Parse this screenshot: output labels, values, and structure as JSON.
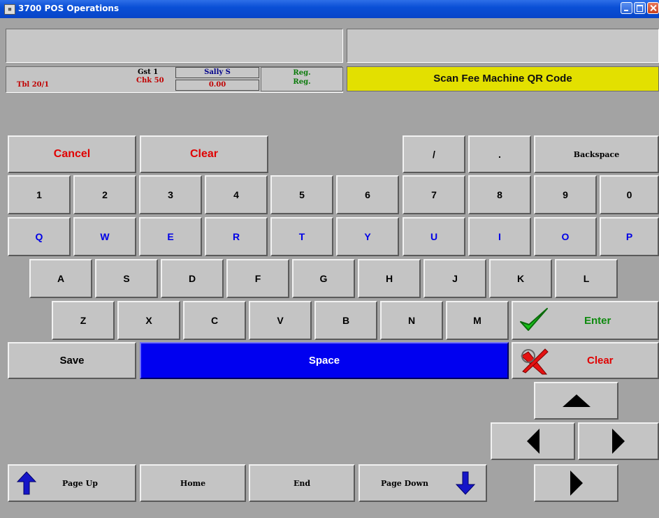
{
  "window": {
    "title": "3700 POS Operations",
    "app_icon": "pos-app-icon"
  },
  "status": {
    "table": "Tbl 20/1",
    "guests": "Gst 1",
    "check": "Chk 50",
    "employee": "Sally S",
    "amount": "0.00",
    "reg1": "Reg.",
    "reg2": "Reg.",
    "prompt": "Scan Fee Machine QR Code"
  },
  "keys": {
    "cancel": "Cancel",
    "clear_top": "Clear",
    "slash": "/",
    "dot": ".",
    "backspace": "Backspace",
    "digits": [
      "1",
      "2",
      "3",
      "4",
      "5",
      "6",
      "7",
      "8",
      "9",
      "0"
    ],
    "row_q": [
      "Q",
      "W",
      "E",
      "R",
      "T",
      "Y",
      "U",
      "I",
      "O",
      "P"
    ],
    "row_a": [
      "A",
      "S",
      "D",
      "F",
      "G",
      "H",
      "J",
      "K",
      "L"
    ],
    "row_z": [
      "Z",
      "X",
      "C",
      "V",
      "B",
      "N",
      "M"
    ],
    "enter": "Enter",
    "save": "Save",
    "space": "Space",
    "clear_bottom": "Clear"
  },
  "nav": {
    "page_up": "Page Up",
    "home": "Home",
    "end": "End",
    "page_down": "Page Down"
  },
  "colors": {
    "prompt_bg": "#e3e000",
    "space_bg": "#0000f0",
    "label_blue": "#0000e6",
    "label_red": "#e00000",
    "label_green": "#0e8a0e"
  }
}
